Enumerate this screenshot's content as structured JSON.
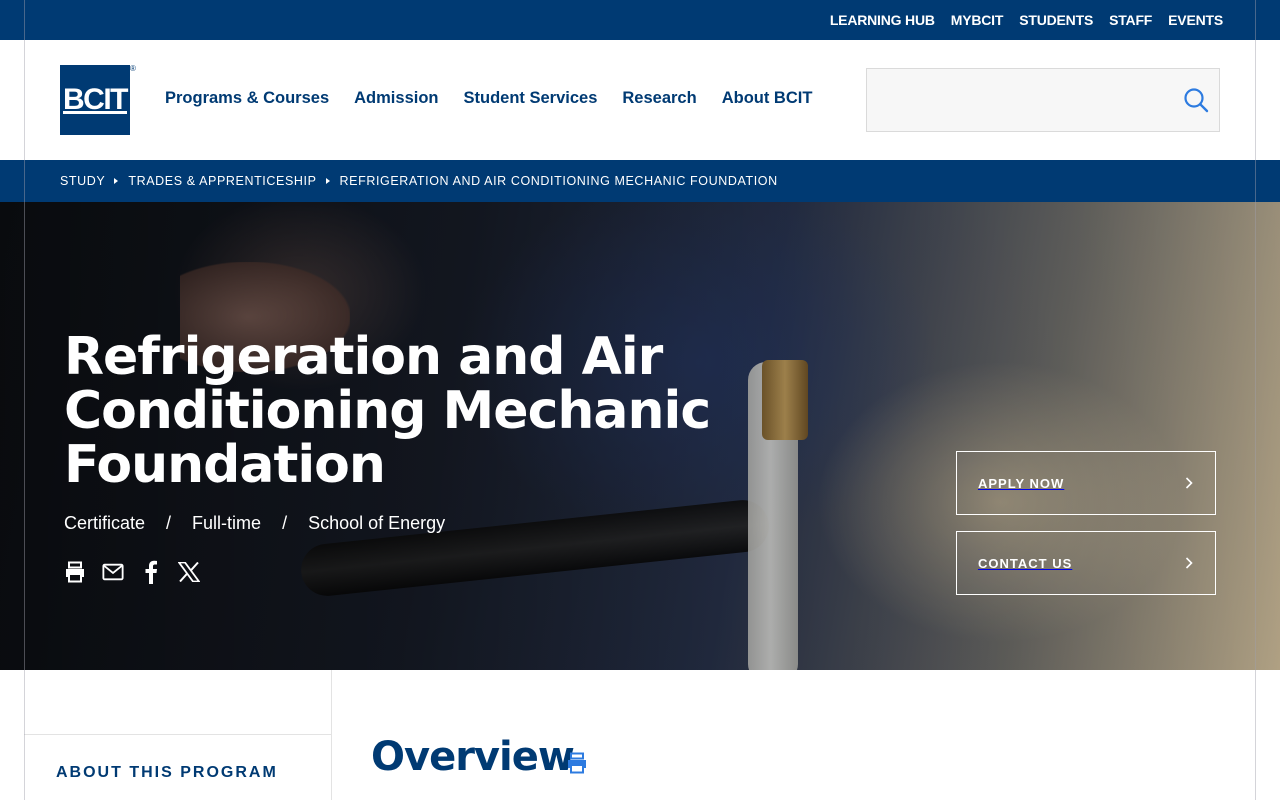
{
  "utility_nav": [
    "LEARNING HUB",
    "MYBCIT",
    "STUDENTS",
    "STAFF",
    "EVENTS"
  ],
  "logo": {
    "text": "BCIT",
    "reg": "®"
  },
  "main_nav": [
    "Programs & Courses",
    "Admission",
    "Student Services",
    "Research",
    "About BCIT"
  ],
  "search": {
    "placeholder": "",
    "icon": "search-icon"
  },
  "breadcrumb": [
    "STUDY",
    "TRADES & APPRENTICESHIP",
    "REFRIGERATION AND AIR CONDITIONING MECHANIC FOUNDATION"
  ],
  "hero": {
    "title_lines": [
      "Refrigeration and Air",
      "Conditioning Mechanic",
      "Foundation"
    ],
    "meta": [
      "Certificate",
      "Full-time",
      "School of Energy"
    ],
    "meta_separator": "/",
    "share_icons": [
      "print-icon",
      "email-icon",
      "facebook-icon",
      "x-icon"
    ],
    "cta": {
      "apply": "APPLY NOW",
      "contact": "CONTACT US"
    }
  },
  "sidebar": {
    "heading": "ABOUT THIS PROGRAM"
  },
  "main": {
    "overview_title": "Overview",
    "print_icon": "print-icon"
  },
  "colors": {
    "primary": "#003a73",
    "accent": "#2d7be0",
    "white": "#ffffff"
  }
}
